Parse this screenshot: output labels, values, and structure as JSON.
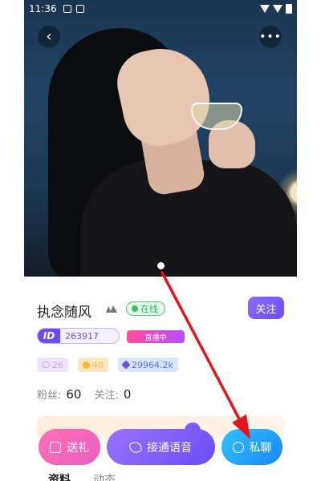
{
  "status_bar": {
    "time": "11:36"
  },
  "header": {
    "back_icon": "chevron-left-icon",
    "more_icon": "more-icon",
    "back_glyph": "‹",
    "more_glyph": "•••"
  },
  "profile": {
    "name": "执念随风",
    "online_label": "在线",
    "follow_label": "关注",
    "id_label": "ID",
    "id_value": "263917",
    "live_label": "直播中",
    "stats": [
      {
        "icon": "bubble-icon",
        "value": "26"
      },
      {
        "icon": "coin-icon",
        "value": "40"
      },
      {
        "icon": "gem-icon",
        "value": "29964.2k"
      }
    ],
    "fans_label": "粉丝:",
    "fans_value": "60",
    "following_label": "关注:",
    "following_value": "0"
  },
  "actions": {
    "gift_label": "送礼",
    "voice_label": "接通语音",
    "chat_label": "私聊"
  },
  "tabs": [
    {
      "label": "资料"
    },
    {
      "label": "动态"
    }
  ],
  "colors": {
    "accent_purple": "#6a4df5",
    "online_green": "#38c06a",
    "gift_pink": "#ff6fae",
    "chat_blue": "#1a86f5",
    "arrow_red": "#e3161b"
  }
}
